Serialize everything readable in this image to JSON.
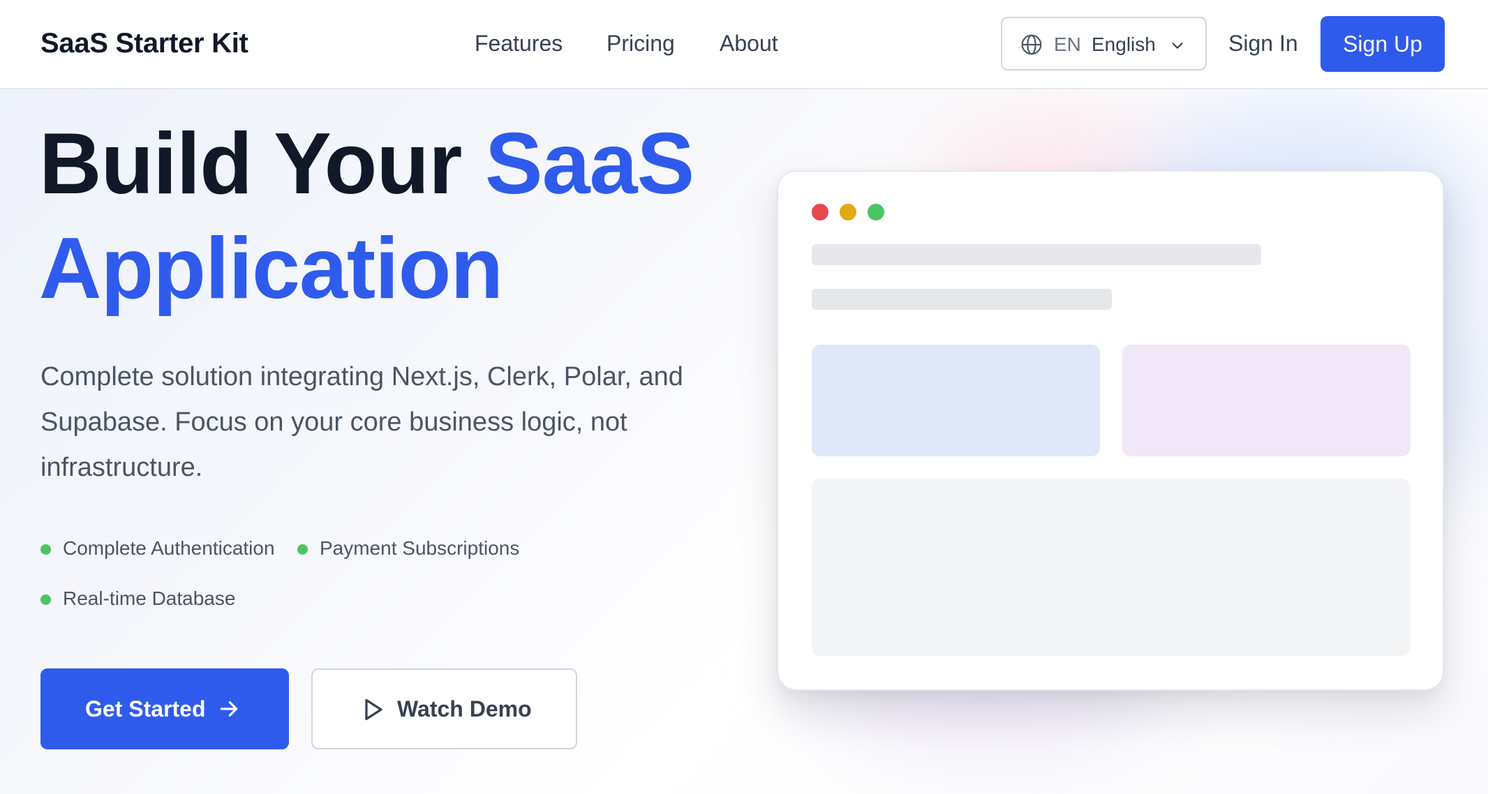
{
  "nav": {
    "brand": "SaaS Starter Kit",
    "links": [
      "Features",
      "Pricing",
      "About"
    ],
    "language": {
      "code": "EN",
      "name": "English",
      "icon": "globe-icon"
    },
    "sign_in": "Sign In",
    "sign_up": "Sign Up"
  },
  "hero": {
    "title_part1": "Build Your ",
    "title_highlight_1": "SaaS",
    "title_highlight_2": "Application",
    "description": "Complete solution integrating Next.js, Clerk, Polar, and Supabase. Focus on your core business logic, not infrastructure.",
    "features": [
      "Complete Authentication",
      "Payment Subscriptions",
      "Real-time Database"
    ],
    "primary_cta": "Get Started",
    "secondary_cta": "Watch Demo"
  },
  "colors": {
    "accent": "#2f5bed",
    "heading": "#111827",
    "body_text": "#4b5563",
    "feature_dot": "#4cc561",
    "window_red": "#e5484d",
    "window_yellow": "#e3a913",
    "window_green": "#4cc561"
  }
}
